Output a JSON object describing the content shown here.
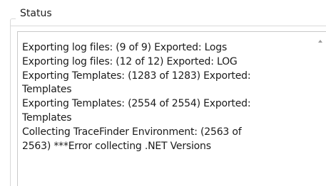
{
  "status": {
    "title": "Status",
    "log_lines": [
      "Exporting log files: (9 of 9) Exported: Logs",
      "Exporting log files: (12 of 12) Exported: LOG",
      "Exporting Templates: (1283 of 1283) Exported:",
      "Templates",
      "Exporting Templates: (2554 of 2554) Exported:",
      "Templates",
      "Collecting TraceFinder Environment: (2563 of",
      "2563) ***Error collecting .NET Versions"
    ]
  },
  "scrollbar": {
    "up_arrow_icon": "chevron-up-icon"
  }
}
